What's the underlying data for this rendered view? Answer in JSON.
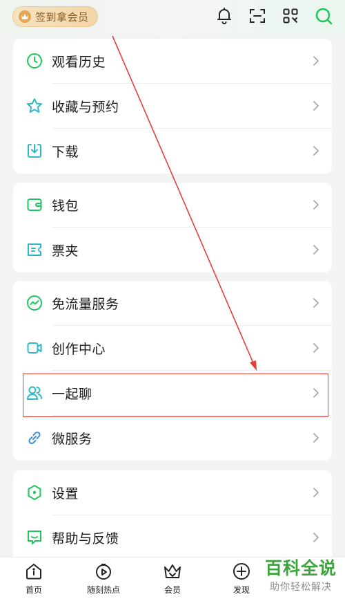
{
  "topbar": {
    "vip_label": "签到拿会员",
    "icons": [
      "bell-icon",
      "scan-icon",
      "qr-code-icon",
      "search-icon"
    ]
  },
  "menu_groups": [
    {
      "items": [
        {
          "label": "观看历史",
          "icon": "clock-icon"
        },
        {
          "label": "收藏与预约",
          "icon": "star-icon"
        },
        {
          "label": "下载",
          "icon": "download-icon"
        }
      ]
    },
    {
      "items": [
        {
          "label": "钱包",
          "icon": "wallet-icon"
        },
        {
          "label": "票夹",
          "icon": "ticket-icon"
        }
      ]
    },
    {
      "items": [
        {
          "label": "免流量服务",
          "icon": "trend-icon"
        },
        {
          "label": "创作中心",
          "icon": "video-camera-icon"
        },
        {
          "label": "一起聊",
          "icon": "people-icon"
        },
        {
          "label": "微服务",
          "icon": "link-icon"
        }
      ]
    },
    {
      "items": [
        {
          "label": "设置",
          "icon": "hex-settings-icon"
        },
        {
          "label": "帮助与反馈",
          "icon": "feedback-icon"
        }
      ]
    }
  ],
  "bottom_tabs": [
    {
      "label": "首页",
      "icon": "home-icon"
    },
    {
      "label": "随刻热点",
      "icon": "hot-icon"
    },
    {
      "label": "会员",
      "icon": "crown-icon"
    },
    {
      "label": "发现",
      "icon": "plus-circle-icon"
    }
  ],
  "watermark": {
    "title": "百科全说",
    "subtitle": "助你轻松解决"
  },
  "colors": {
    "accent": "#1ec75b",
    "highlight": "#e0403a",
    "vip_text": "#8a5a22"
  }
}
